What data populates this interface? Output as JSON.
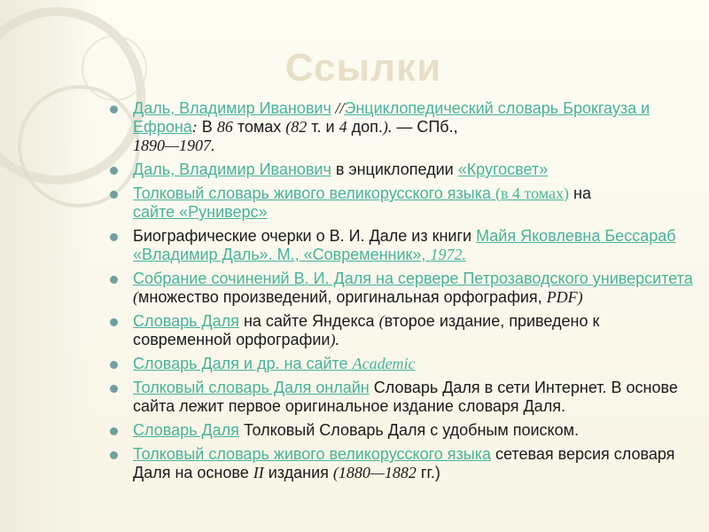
{
  "slide": {
    "title": "Ссылки",
    "items": [
      {
        "link1": "Даль, Владимир Иванович",
        "sep": " //",
        "link2": "Энциклопедический словарь Брокгауза и Ефрона",
        "colon": ":",
        "text_a": " В ",
        "num1": "86",
        "text_b": " томах ",
        "paren1": "(82",
        "text_c": " т. и ",
        "num2": "4",
        "text_d": " доп.",
        "paren2": ").",
        "dash": " — ",
        "text_e": "СПб.,",
        "years": "1890—1907."
      },
      {
        "link1": "Даль, Владимир Иванович",
        "text": " в энциклопедии ",
        "link2": "«Кругосвет»"
      },
      {
        "link1": "Толковый словарь живого великорусского языка ",
        "link_paren": "(в 4 томах)",
        "text": " на",
        "link2": "сайте «Руниверс»"
      },
      {
        "text": "Биографические очерки о В. И. Дале из книги ",
        "link1": "Майя Яковлевна Бессараб «Владимир Даль». М., «Современник», ",
        "year": "1972."
      },
      {
        "link1": "Собрание сочинений В. И. Даля на сервере Петрозаводского университета",
        "paren_open": " (",
        "text": "множество произведений, оригинальная орфография, ",
        "pdf": "PDF)"
      },
      {
        "link1": "Словарь Даля",
        "text": " на сайте Яндекса ",
        "paren_open": "(",
        "text2": "второе издание, приведено к современной орфографии",
        "paren_close": ")."
      },
      {
        "link1": "Словарь Даля и др. на сайте ",
        "link_serif": "Academic"
      },
      {
        "link1": "Толковый словарь Даля онлайн",
        "text": " Словарь Даля в сети Интернет. В основе сайта лежит первое оригинальное издание словаря Даля."
      },
      {
        "link1": "Словарь Даля",
        "text": " Толковый Словарь Даля с удобным поиском."
      },
      {
        "link1": "Толковый словарь живого великорусского языка",
        "text": " сетевая версия словаря Даля на основе ",
        "roman": "II",
        "text2": " издания ",
        "years": "(1880—1882",
        "text3": " гг.)"
      }
    ]
  },
  "colors": {
    "link": "#47b39a",
    "bullet": "#6f9fa3",
    "title": "#e9dfc8",
    "background": "#f8f5e6"
  }
}
